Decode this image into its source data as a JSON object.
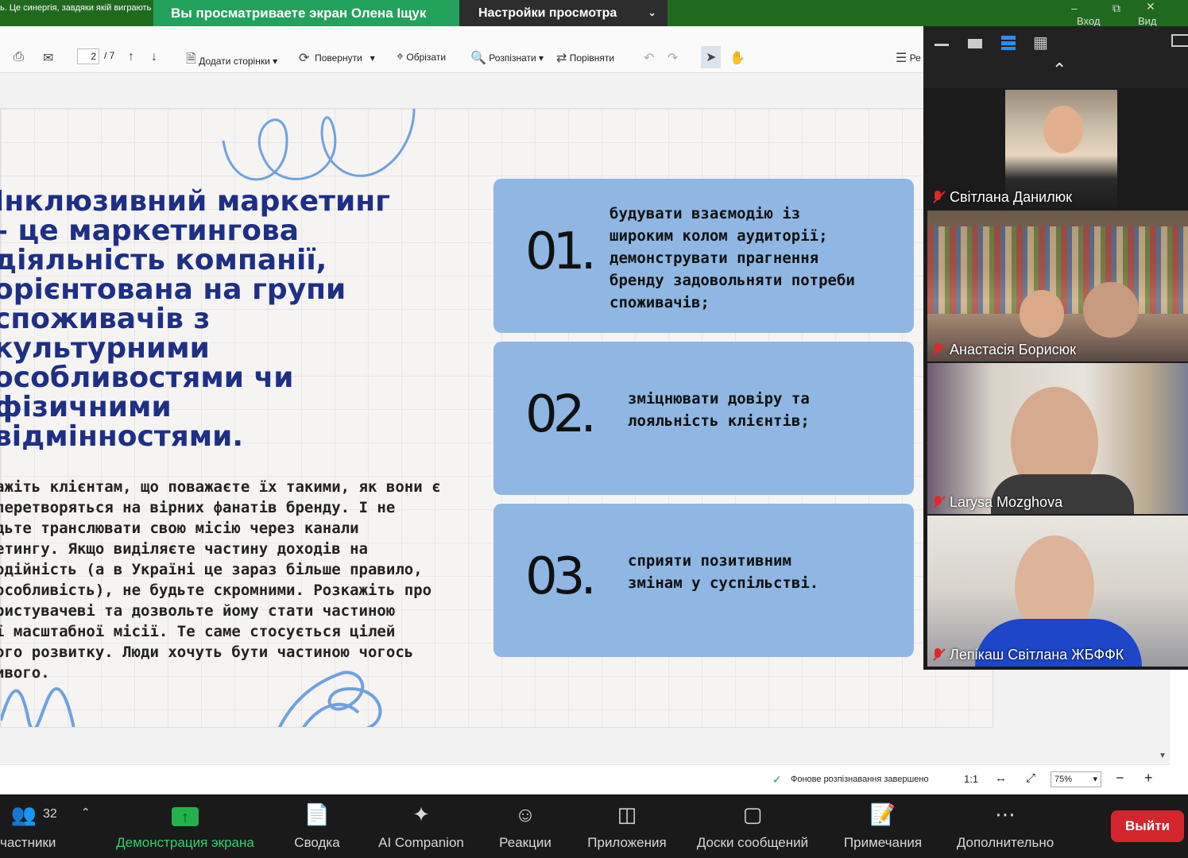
{
  "top": {
    "title_text": "ь. Це синергія, завдяки якій виграють",
    "share_banner": "Вы просматриваете экран Олена Іщук",
    "view_options": "Настройки просмотра",
    "win_labels": [
      "Вход",
      "Вид"
    ]
  },
  "pdf_toolbar": {
    "page_current": "2",
    "page_total": "/ 7",
    "add_pages": "Додати сторінки",
    "rotate": "Повернути",
    "crop": "Обрізати",
    "recognize": "Розпізнати",
    "compare": "Порівняти",
    "right_cut": "Ре"
  },
  "slide": {
    "heading": "Інклюзивний маркетинг\n– це маркетингова\nдіяльність компанії,\nорієнтована на групи\nспоживачів з\nкультурними\nособливостями чи\nфізичними\nвідмінностями.",
    "body": "ажіть клієнтам, що поважаєте їх такими, як вони є\n перетворяться на вірних фанатів бренду. І не\nдьте транслювати свою місію через канали\nетингу. Якщо виділяєте частину доходів на\nодійність (а в Україні це зараз більше правило,\nособливість), не будьте скромними. Розкажіть про\nристувачеві та дозвольте йому стати частиною\nї масштабної місії. Те саме стосується цілей\nого розвитку. Люди хочуть бути частиною чогось\nивого.",
    "cards": [
      {
        "num": "01.",
        "text": "будувати взаємодію із\nшироким колом аудиторії;\nдемонструвати прагнення\nбренду задовольняти потреби\nспоживачів;"
      },
      {
        "num": "02.",
        "text": "зміцнювати довіру та\nлояльність клієнтів;"
      },
      {
        "num": "03.",
        "text": "сприяти позитивним\nзмінам у суспільстві."
      }
    ]
  },
  "statusbar": {
    "ocr_status": "Фонове розпізнавання завершено",
    "ratio": "1:1",
    "zoom": "75%"
  },
  "participants": [
    {
      "name": "Світлана Данилюк",
      "muted": true
    },
    {
      "name": "Анастасія Борисюк",
      "muted": true
    },
    {
      "name": "Larysa Mozghova",
      "muted": true
    },
    {
      "name": "Лепікаш Світлана ЖБФФК",
      "muted": true
    }
  ],
  "bottombar": {
    "participants_label": "частники",
    "participants_count": "32",
    "share_screen": "Демонстрация экрана",
    "summary": "Сводка",
    "ai_companion": "AI Companion",
    "reactions": "Реакции",
    "apps": "Приложения",
    "whiteboards": "Доски сообщений",
    "notes": "Примечания",
    "more": "Дополнительно",
    "leave": "Выйти"
  },
  "colors": {
    "share_green": "#23a25b",
    "heading_blue": "#1e2f86",
    "card_blue": "#90b6e3",
    "leave_red": "#d3262c"
  }
}
